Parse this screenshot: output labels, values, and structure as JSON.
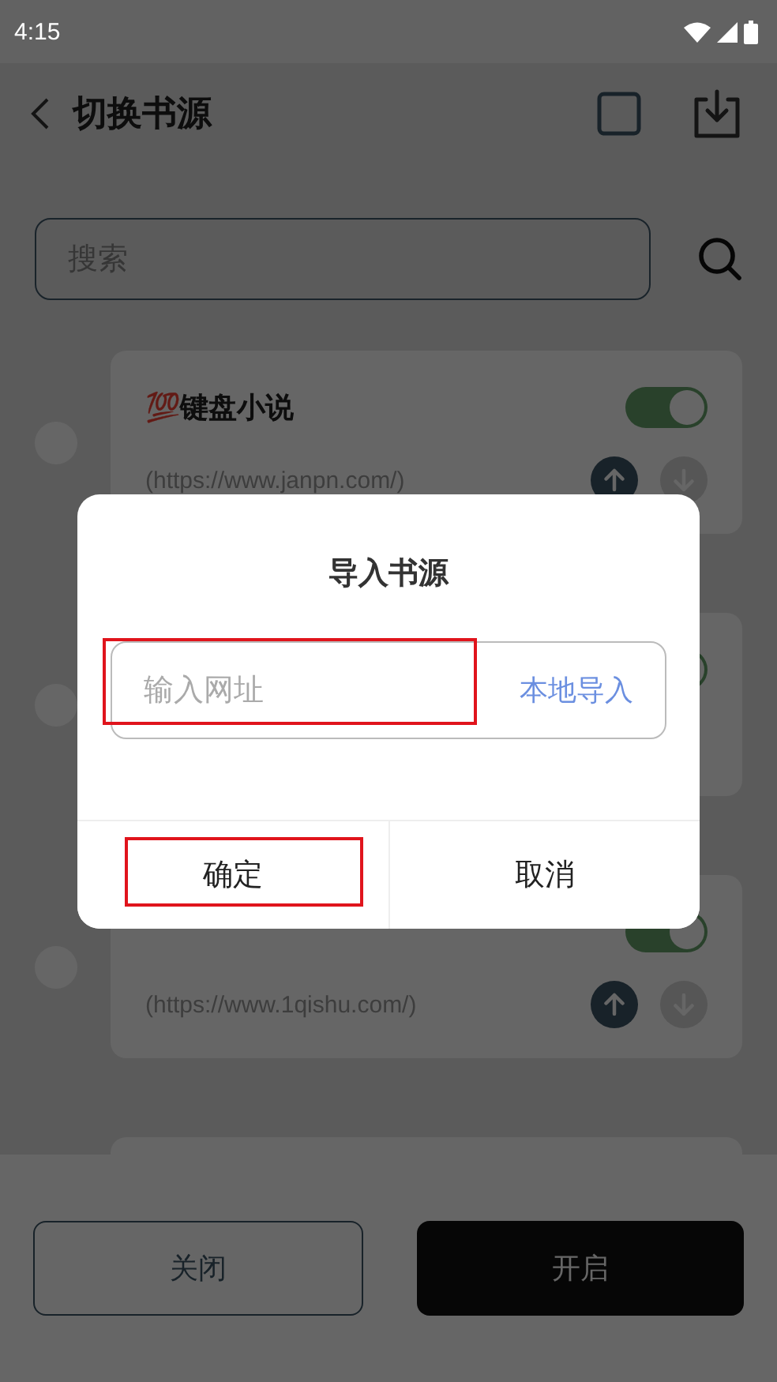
{
  "status_bar": {
    "time": "4:15"
  },
  "header": {
    "title": "切换书源",
    "select_all_checked": false
  },
  "search": {
    "placeholder": "搜索"
  },
  "sources": [
    {
      "name": "💯键盘小说",
      "url": "(https://www.janpn.com/)",
      "on": true,
      "selected": false
    },
    {
      "on": true,
      "selected": false
    },
    {
      "url": "(https://www.1qishu.com/)",
      "on": true,
      "selected": false
    }
  ],
  "footer": {
    "buttons": [
      {
        "label": "关闭",
        "kind": "outline"
      },
      {
        "label": "开启",
        "kind": "filled"
      }
    ]
  },
  "dialog": {
    "title": "导入书源",
    "field": {
      "placeholder": "输入网址",
      "highlighted": true
    },
    "local_import": "本地导入",
    "buttons": [
      {
        "label": "确定",
        "highlighted": true
      },
      {
        "label": "取消",
        "highlighted": false
      }
    ]
  }
}
